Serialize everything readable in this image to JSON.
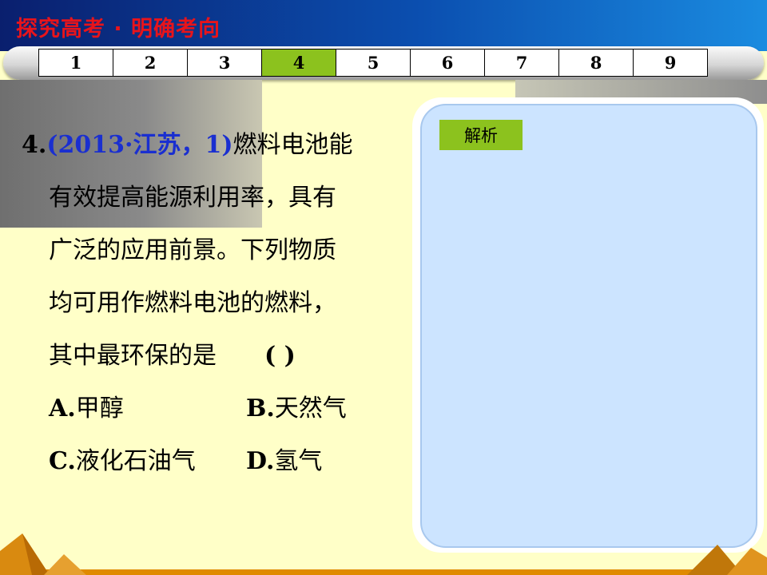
{
  "header": {
    "title": "探究高考 · 明确考向"
  },
  "nav": {
    "tabs": [
      "1",
      "2",
      "3",
      "4",
      "5",
      "6",
      "7",
      "8",
      "9"
    ],
    "active_index": 3
  },
  "question": {
    "number": "4.",
    "source": "(2013·江苏，1)",
    "lines": [
      "燃料电池能",
      "有效提高能源利用率，具有",
      "广泛的应用前景。下列物质",
      "均可用作燃料电池的燃料，",
      "其中最环保的是"
    ],
    "blank": "(    )",
    "options": {
      "A": {
        "label": "A.",
        "text": "甲醇"
      },
      "B": {
        "label": "B.",
        "text": "天然气"
      },
      "C": {
        "label": "C.",
        "text": "液化石油气"
      },
      "D": {
        "label": "D.",
        "text": "氢气"
      }
    }
  },
  "analysis": {
    "button_label": "解析"
  },
  "colors": {
    "background": "#ffffc8",
    "header_title": "#e8141b",
    "accent_green": "#8cc21e",
    "source_blue": "#1a2fd0",
    "analysis_fill": "#cce4ff"
  }
}
